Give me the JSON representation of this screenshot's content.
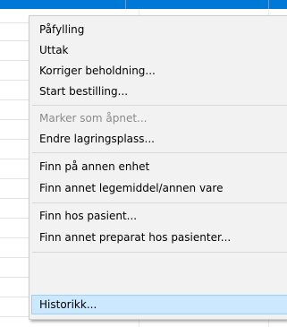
{
  "colors": {
    "selection_bar": "#0078d7",
    "menu_background": "#f2f2f2",
    "highlight_background": "#cce8ff",
    "highlight_border": "#99d1ff",
    "disabled_text": "#8a8a8a"
  },
  "context_menu": {
    "items": [
      {
        "label": "Påfylling",
        "enabled": true
      },
      {
        "label": "Uttak",
        "enabled": true
      },
      {
        "label": "Korriger beholdning...",
        "enabled": true
      },
      {
        "label": "Start bestilling...",
        "enabled": true
      },
      {
        "label": "Marker som åpnet...",
        "enabled": false
      },
      {
        "label": "Endre lagringsplass...",
        "enabled": true
      },
      {
        "label": "Finn på annen enhet",
        "enabled": true
      },
      {
        "label": "Finn annet legemiddel/annen vare",
        "enabled": true
      },
      {
        "label": "Finn hos pasient...",
        "enabled": true
      },
      {
        "label": "Finn annet preparat hos pasienter...",
        "enabled": true
      },
      {
        "label": "Historikk...",
        "enabled": true,
        "highlighted": true
      }
    ]
  }
}
